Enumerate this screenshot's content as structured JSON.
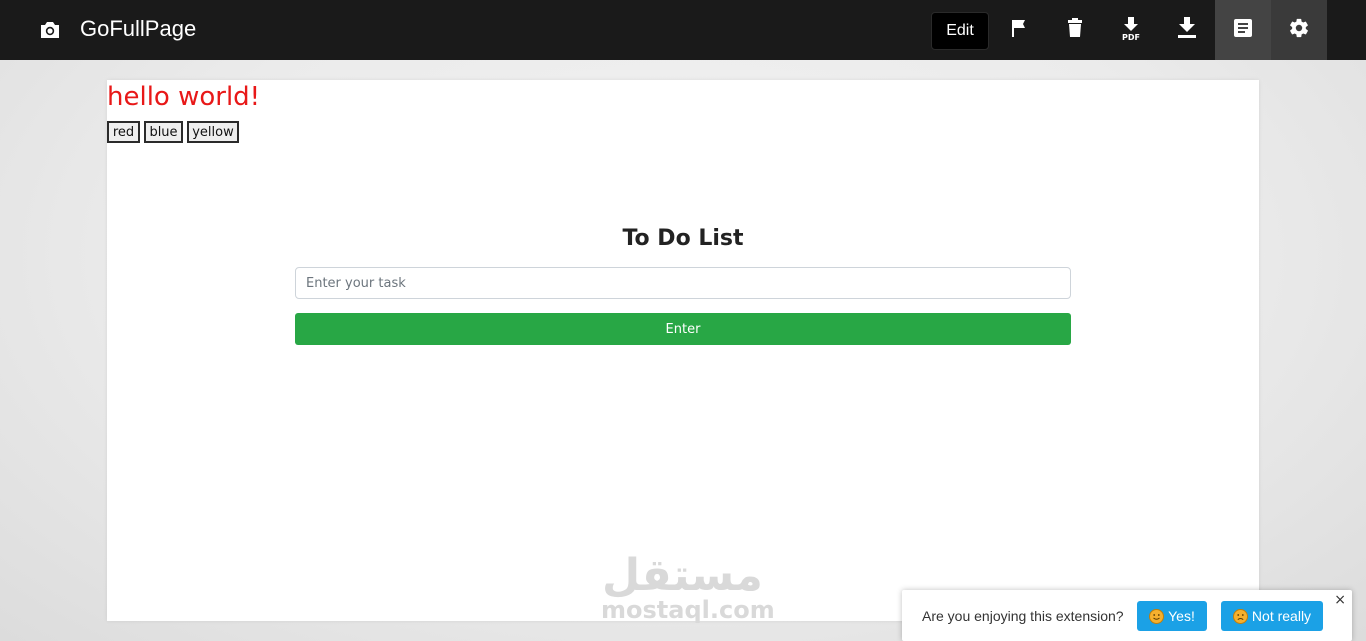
{
  "app": {
    "title": "GoFullPage",
    "camera_icon": "camera-icon"
  },
  "toolbar": {
    "edit_label": "Edit",
    "flag_icon": "flag-icon",
    "trash_icon": "trash-icon",
    "pdf_download_icon": "pdf-download-icon",
    "pdf_label": "PDF",
    "download_icon": "download-icon",
    "notes_icon": "notes-icon",
    "settings_icon": "gear-icon"
  },
  "page": {
    "heading": "hello world!",
    "color_buttons": [
      "red",
      "blue",
      "yellow"
    ],
    "todo_title": "To Do List",
    "task_placeholder": "Enter your task",
    "enter_label": "Enter"
  },
  "watermark": {
    "arabic": "مستقل",
    "latin": "mostaql.com"
  },
  "feedback": {
    "question": "Are you enjoying this extension?",
    "yes_label": "Yes!",
    "no_label": "Not really",
    "close_label": "×"
  },
  "colors": {
    "topbar": "#1a1a1a",
    "heading": "#e81818",
    "enter_button": "#28a745",
    "feedback_button": "#1ba1e6"
  }
}
